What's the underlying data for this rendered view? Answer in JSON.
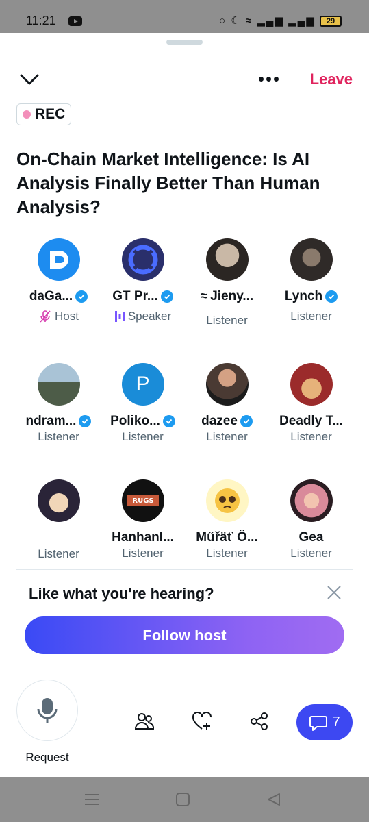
{
  "status_bar": {
    "time": "11:21",
    "battery": "29",
    "icons": [
      "youtube-icon",
      "headphones-icon",
      "moon-icon",
      "wifi-icon",
      "signal-icon",
      "signal-icon",
      "battery-icon"
    ]
  },
  "header": {
    "leave_label": "Leave",
    "rec_label": "REC"
  },
  "space": {
    "title": "On-Chain Market Intelligence: Is AI Analysis Finally Better Than Human Analysis?"
  },
  "participants": [
    {
      "name": "daGa...",
      "verified": true,
      "role": "Host"
    },
    {
      "name": "GT Pr...",
      "verified": true,
      "role": "Speaker"
    },
    {
      "name": "Jieny...",
      "verified": false,
      "role": "Listener"
    },
    {
      "name": "Lynch",
      "verified": true,
      "role": "Listener"
    },
    {
      "name": "ndram...",
      "verified": true,
      "role": "Listener"
    },
    {
      "name": "Poliko...",
      "verified": true,
      "role": "Listener",
      "avatar_letter": "P"
    },
    {
      "name": "dazee",
      "verified": true,
      "role": "Listener"
    },
    {
      "name": "Deadly T...",
      "verified": false,
      "role": "Listener"
    },
    {
      "name": "",
      "verified": false,
      "role": "Listener"
    },
    {
      "name": "HanhanI...",
      "verified": false,
      "role": "Listener"
    },
    {
      "name": "Műřäť Ö...",
      "verified": false,
      "role": "Listener"
    },
    {
      "name": "Gea",
      "verified": false,
      "role": "Listener"
    }
  ],
  "promo": {
    "text": "Like what you're hearing?",
    "button": "Follow host"
  },
  "toolbar": {
    "request_label": "Request",
    "chat_count": "7"
  },
  "colors": {
    "leave": "#e0245e",
    "accent": "#3d48f2",
    "verified": "#1d9bf0",
    "rec_dot": "#f38fba"
  }
}
